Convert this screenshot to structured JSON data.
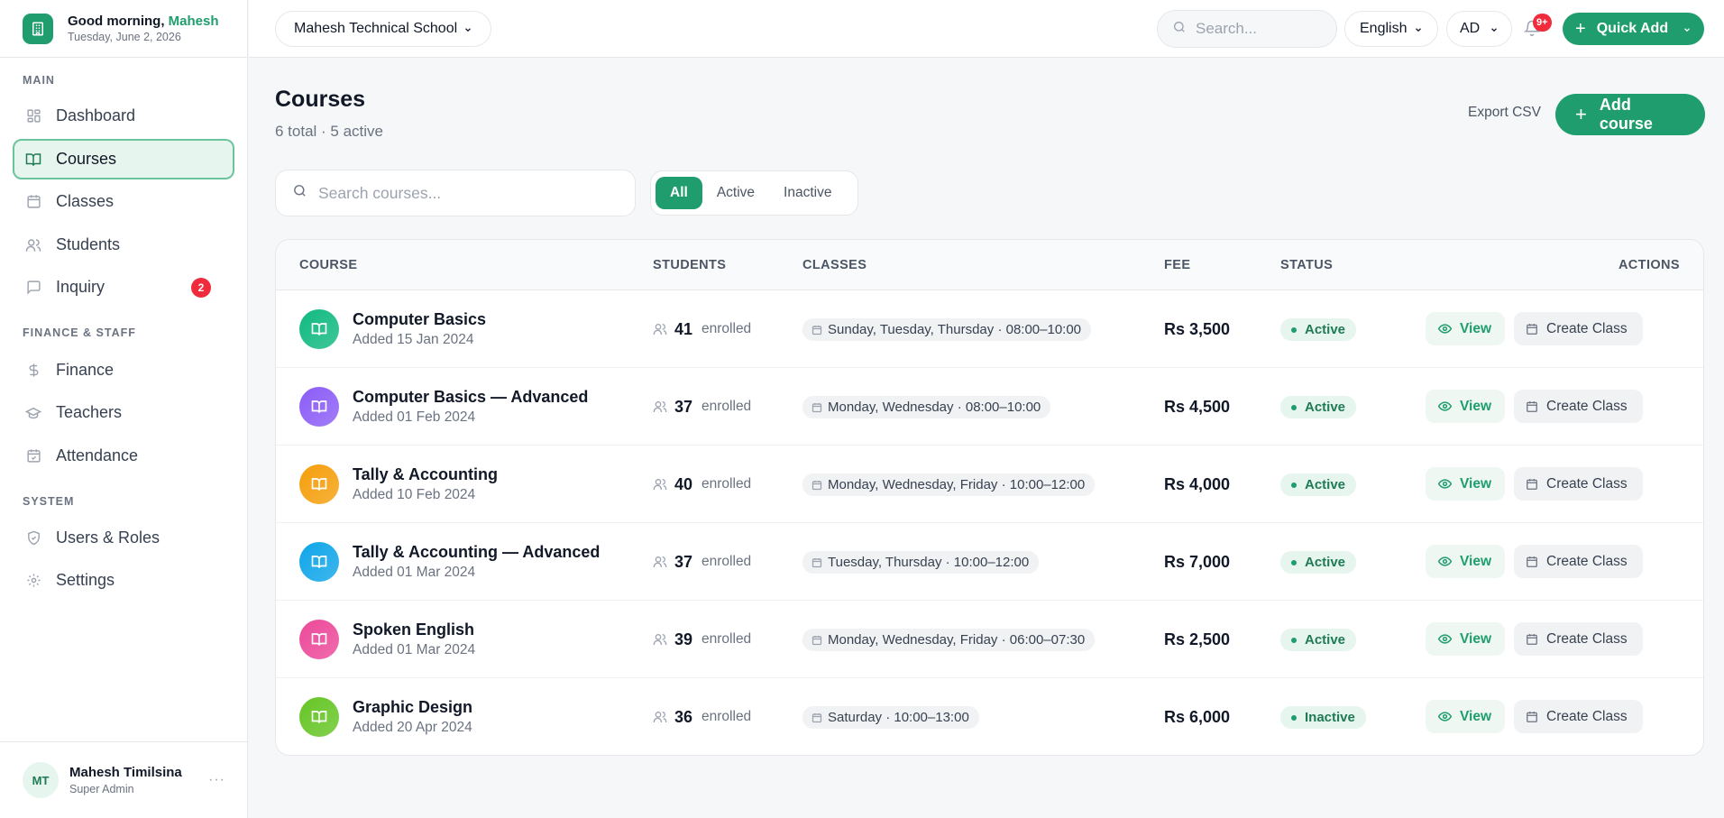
{
  "brand": {
    "greeting": "Good morning,",
    "user_first": "Mahesh",
    "date": "Tuesday, June 2, 2026"
  },
  "sidebar": {
    "sections": [
      {
        "label": "MAIN"
      },
      {
        "label": "FINANCE & STAFF"
      },
      {
        "label": "SYSTEM"
      }
    ],
    "items": [
      {
        "label": "Dashboard",
        "icon": "grid-icon"
      },
      {
        "label": "Courses",
        "icon": "book-icon"
      },
      {
        "label": "Classes",
        "icon": "calendar-icon"
      },
      {
        "label": "Students",
        "icon": "users-icon"
      },
      {
        "label": "Inquiry",
        "icon": "message-icon",
        "badge": "2"
      },
      {
        "label": "Finance",
        "icon": "dollar-icon"
      },
      {
        "label": "Teachers",
        "icon": "graduation-cap-icon"
      },
      {
        "label": "Attendance",
        "icon": "calendar-check-icon"
      },
      {
        "label": "Users & Roles",
        "icon": "shield-icon"
      },
      {
        "label": "Settings",
        "icon": "gear-icon"
      }
    ],
    "user": {
      "initials": "MT",
      "name": "Mahesh Timilsina",
      "role": "Super Admin"
    }
  },
  "topbar": {
    "school": "Mahesh Technical School",
    "search_placeholder": "Search...",
    "language": "English",
    "calendar": "AD",
    "notifications_badge": "9+",
    "quick_add": "Quick Add"
  },
  "page": {
    "title": "Courses",
    "subtitle": "6 total · 5 active",
    "export_label": "Export CSV",
    "add_label": "Add course",
    "search_placeholder": "Search courses...",
    "filters": [
      "All",
      "Active",
      "Inactive"
    ],
    "active_filter": "All"
  },
  "table": {
    "columns": [
      "COURSE",
      "STUDENTS",
      "CLASSES",
      "FEE",
      "STATUS",
      "ACTIONS"
    ],
    "enrolled_label": "enrolled",
    "view_label": "View",
    "create_label": "Create Class",
    "rows": [
      {
        "name": "Computer Basics",
        "added": "Added 15 Jan 2024",
        "students": "41",
        "schedule": "Sunday, Tuesday, Thursday · 08:00–10:00",
        "fee": "Rs 3,500",
        "status": "Active",
        "color": "#10b981"
      },
      {
        "name": "Computer Basics — Advanced",
        "added": "Added 01 Feb 2024",
        "students": "37",
        "schedule": "Monday, Wednesday · 08:00–10:00",
        "fee": "Rs 4,500",
        "status": "Active",
        "color": "#8b5cf6"
      },
      {
        "name": "Tally & Accounting",
        "added": "Added 10 Feb 2024",
        "students": "40",
        "schedule": "Monday, Wednesday, Friday · 10:00–12:00",
        "fee": "Rs 4,000",
        "status": "Active",
        "color": "#f59e0b"
      },
      {
        "name": "Tally & Accounting — Advanced",
        "added": "Added 01 Mar 2024",
        "students": "37",
        "schedule": "Tuesday, Thursday · 10:00–12:00",
        "fee": "Rs 7,000",
        "status": "Active",
        "color": "#0ea5e9"
      },
      {
        "name": "Spoken English",
        "added": "Added 01 Mar 2024",
        "students": "39",
        "schedule": "Monday, Wednesday, Friday · 06:00–07:30",
        "fee": "Rs 2,500",
        "status": "Active",
        "color": "#ec4899"
      },
      {
        "name": "Graphic Design",
        "added": "Added 20 Apr 2024",
        "students": "36",
        "schedule": "Saturday · 10:00–13:00",
        "fee": "Rs 6,000",
        "status": "Inactive",
        "color": "#65c524"
      }
    ]
  },
  "colors": {
    "accent": "#1f9d6e",
    "danger": "#ef2b3c"
  }
}
